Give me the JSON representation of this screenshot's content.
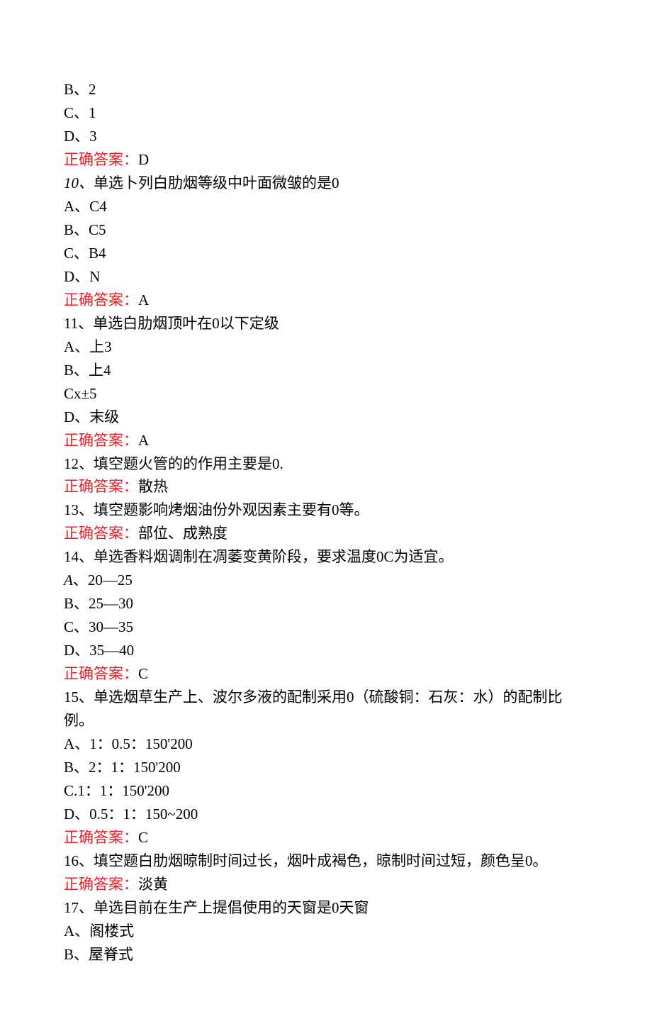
{
  "lines": {
    "l1": "B、2",
    "l2": "C、1",
    "l3": "D、3",
    "l4a": "正确答案：",
    "l4b": "D",
    "l5a": "10、",
    "l5b": "单选卜列白肋烟等级中叶面微皱的是0",
    "l6": "A、C4",
    "l7": "B、C5",
    "l8": "C、B4",
    "l9": "D、N",
    "l10a": "正确答案：",
    "l10b": "A",
    "l11": "11、单选白肋烟顶叶在0以下定级",
    "l12": "A、上3",
    "l13": "B、上4",
    "l14": "Cx±5",
    "l15": "D、末级",
    "l16a": "正确答案：",
    "l16b": "A",
    "l17": "12、填空题火管的的作用主要是0.",
    "l18a": "正确答案：",
    "l18b": "散热",
    "l19": "13、填空题影响烤烟油份外观因素主要有0等。",
    "l20a": "正确答案：",
    "l20b": "部位、成熟度",
    "l21": "14、单选香料烟调制在凋萎变黄阶段，要求温度0C为适宜。",
    "l22a": "A",
    "l22b": "、20—25",
    "l23": "B、25—30",
    "l24": "C、30—35",
    "l25": "D、35—40",
    "l26a": "正确答案：",
    "l26b": "C",
    "l27": "15、单选烟草生产上、波尔多液的配制采用0（硫酸铜：石灰：水）的配制比例。",
    "l28": "A、1：0.5：150'200",
    "l29": "B、2：1：150'200",
    "l30": "C.1：1：150'200",
    "l31": "D、0.5：1：150~200",
    "l32a": "正确答案：",
    "l32b": "C",
    "l33": "16、填空题白肋烟晾制时间过长，烟叶成褐色，晾制时间过短，颜色呈0。",
    "l34a": "正确答案：",
    "l34b": "淡黄",
    "l35": "17、单选目前在生产上提倡使用的天窗是0天窗",
    "l36": "A、阁楼式",
    "l37": "B、屋脊式"
  }
}
